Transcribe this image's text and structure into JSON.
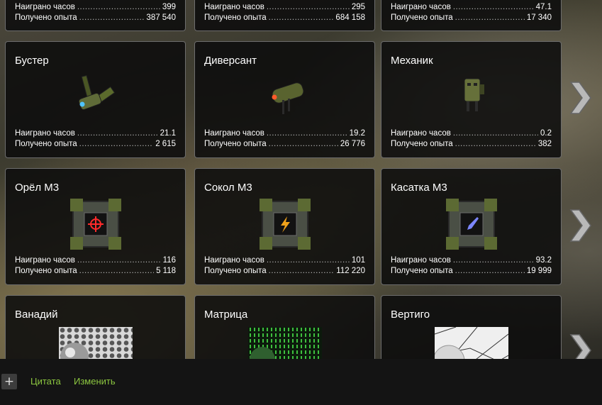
{
  "cards": [
    {
      "title": "",
      "hours_label": "Наиграно часов",
      "hours": "399",
      "exp_label": "Получено опыта",
      "exp": "387 540"
    },
    {
      "title": "",
      "hours_label": "Наиграно часов",
      "hours": "295",
      "exp_label": "Получено опыта",
      "exp": "684 158"
    },
    {
      "title": "",
      "hours_label": "Наиграно часов",
      "hours": "47.1",
      "exp_label": "Получено опыта",
      "exp": "17 340"
    },
    {
      "title": "Бустер",
      "hours_label": "Наиграно часов",
      "hours": "21.1",
      "exp_label": "Получено опыта",
      "exp": "2 615",
      "icon": "booster-drone-icon"
    },
    {
      "title": "Диверсант",
      "hours_label": "Наиграно часов",
      "hours": "19.2",
      "exp_label": "Получено опыта",
      "exp": "26 776",
      "icon": "saboteur-drone-icon"
    },
    {
      "title": "Механик",
      "hours_label": "Наиграно часов",
      "hours": "0.2",
      "exp_label": "Получено опыта",
      "exp": "382",
      "icon": "mechanic-drone-icon"
    },
    {
      "title": "Орёл М3",
      "hours_label": "Наиграно часов",
      "hours": "116",
      "exp_label": "Получено опыта",
      "exp": "5 118",
      "icon": "crosshair-module-icon"
    },
    {
      "title": "Сокол М3",
      "hours_label": "Наиграно часов",
      "hours": "101",
      "exp_label": "Получено опыта",
      "exp": "112 220",
      "icon": "lightning-module-icon"
    },
    {
      "title": "Касатка М3",
      "hours_label": "Наиграно часов",
      "hours": "93.2",
      "exp_label": "Получено опыта",
      "exp": "19 999",
      "icon": "rocket-module-icon"
    },
    {
      "title": "Ванадий",
      "icon": "vanadium-paint-icon"
    },
    {
      "title": "Матрица",
      "icon": "matrix-paint-icon"
    },
    {
      "title": "Вертиго",
      "icon": "vertigo-paint-icon"
    }
  ],
  "footer": {
    "plus_label": "+",
    "quote_label": "Цитата",
    "edit_label": "Изменить"
  },
  "colors": {
    "link": "#8cc640",
    "card_border": "#6d6d6d",
    "card_bg": "#0c0c0c"
  }
}
